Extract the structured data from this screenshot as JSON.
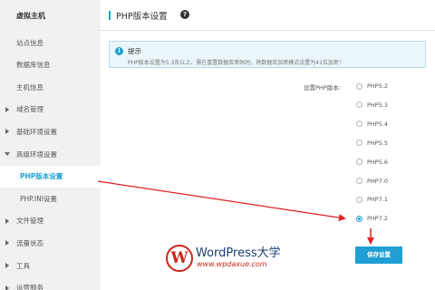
{
  "sidebar": {
    "title": "虚拟主机",
    "items": [
      {
        "label": "站点信息",
        "arrow": "none",
        "sub": false,
        "active": false
      },
      {
        "label": "数据库信息",
        "arrow": "none",
        "sub": false,
        "active": false
      },
      {
        "label": "主机信息",
        "arrow": "none",
        "sub": false,
        "active": false
      },
      {
        "label": "域名管理",
        "arrow": "right",
        "sub": false,
        "active": false
      },
      {
        "label": "基础环境设置",
        "arrow": "right",
        "sub": false,
        "active": false
      },
      {
        "label": "高级环境设置",
        "arrow": "down",
        "sub": false,
        "active": false
      },
      {
        "label": "PHP版本设置",
        "arrow": "none",
        "sub": true,
        "active": true
      },
      {
        "label": "PHP.INI设置",
        "arrow": "none",
        "sub": true,
        "active": false
      },
      {
        "label": "文件管理",
        "arrow": "right",
        "sub": false,
        "active": false
      },
      {
        "label": "流量状态",
        "arrow": "right",
        "sub": false,
        "active": false
      },
      {
        "label": "工具",
        "arrow": "right",
        "sub": false,
        "active": false
      },
      {
        "label": "运营服务",
        "arrow": "right",
        "sub": false,
        "active": false
      }
    ]
  },
  "header": {
    "title": "PHP版本设置",
    "help_icon": "?"
  },
  "notice": {
    "icon": "i",
    "title": "提示",
    "text": "PHP版本设置为5.3及以上，需在重置数据库密码时，将数据库加密模式设置为41位加密！"
  },
  "form": {
    "label": "设置PHP版本:",
    "selected": "PHP7.2",
    "options": [
      "PHP5.2",
      "PHP5.3",
      "PHP5.4",
      "PHP5.5",
      "PHP5.6",
      "PHP7.0",
      "PHP7.1",
      "PHP7.2"
    ],
    "save_label": "保存设置"
  },
  "watermark": {
    "logo": "W",
    "title": "WordPress大学",
    "url": "www.wpdaxue.com"
  },
  "colors": {
    "accent": "#1f9fd4",
    "arrow": "#e02020",
    "watermark_red": "#c9261b",
    "watermark_blue": "#1a3e72"
  }
}
